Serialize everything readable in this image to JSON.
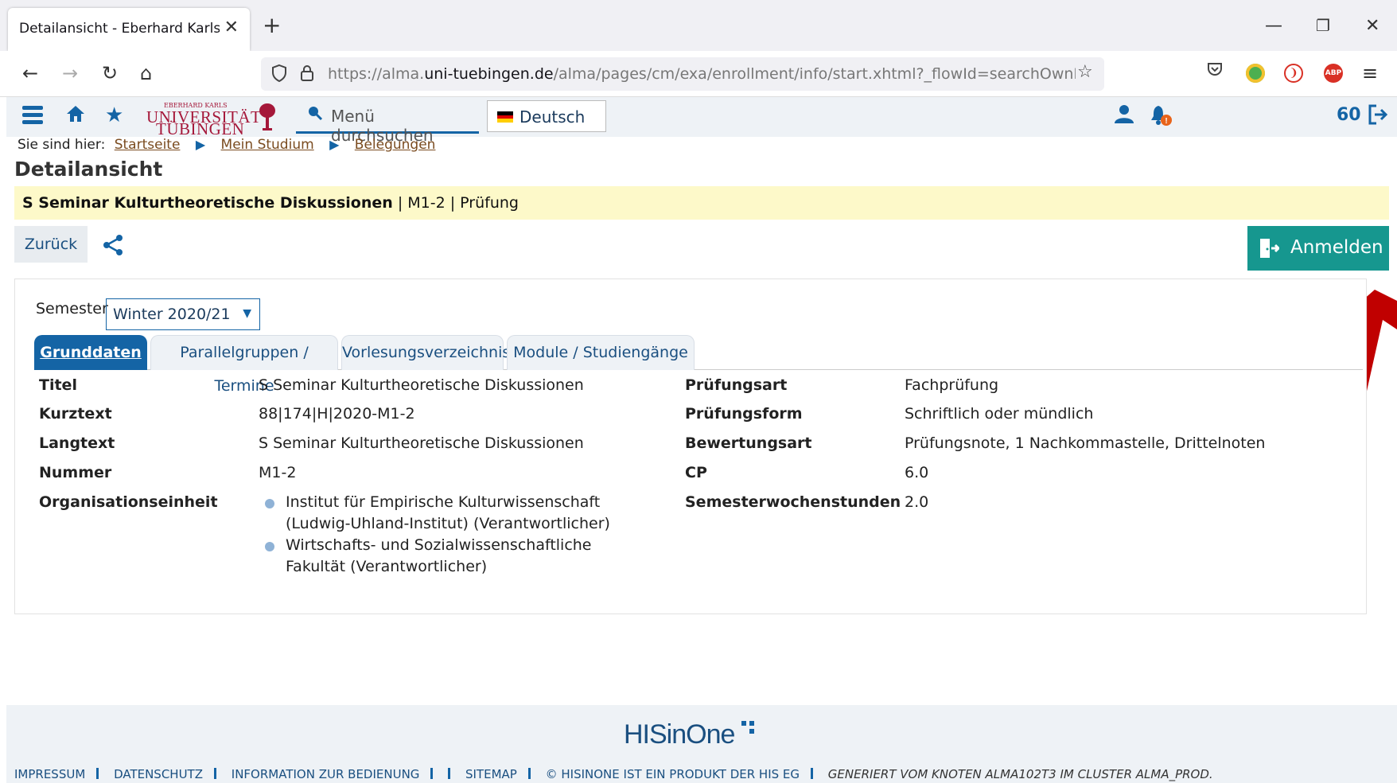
{
  "browser": {
    "tab_title": "Detailansicht - Eberhard Karls Unive",
    "url_prefix": "https://alma.",
    "url_domain": "uni-tuebingen.de",
    "url_path": "/alma/pages/cm/exa/enrollment/info/start.xhtml?_flowId=searchOwnEnrollmentIn"
  },
  "header": {
    "logo_sub": "EBERHARD KARLS",
    "logo_line1": "UNIVERSITÄT",
    "logo_line2": "TÜBINGEN",
    "menu_search": "Menü durchsuchen",
    "language": "Deutsch",
    "counter": "60"
  },
  "breadcrumb": {
    "prefix": "Sie sind hier:",
    "items": [
      "Startseite",
      "Mein Studium",
      "Belegungen"
    ]
  },
  "page_title": "Detailansicht",
  "course_bar": "S Seminar Kulturtheoretische Diskussionen",
  "course_bar_suffix": " | M1-2 | Prüfung",
  "actions": {
    "back": "Zurück",
    "register": "Anmelden"
  },
  "semester": {
    "label": "Semester",
    "selected": "Winter 2020/21"
  },
  "tabs": [
    "Grunddaten",
    "Parallelgruppen / Termine",
    "Vorlesungsverzeichnis",
    "Module / Studiengänge"
  ],
  "details_left": [
    {
      "label": "Titel",
      "value": "S Seminar Kulturtheoretische Diskussionen"
    },
    {
      "label": "Kurztext",
      "value": "88|174|H|2020-M1-2"
    },
    {
      "label": "Langtext",
      "value": "S Seminar Kulturtheoretische Diskussionen"
    },
    {
      "label": "Nummer",
      "value": "M1-2"
    },
    {
      "label": "Organisationseinheit"
    }
  ],
  "org_units": [
    {
      "line1": "Institut für Empirische Kulturwissenschaft",
      "line2": "(Ludwig-Uhland-Institut) (Verantwortlicher)"
    },
    {
      "line1": "Wirtschafts- und Sozialwissenschaftliche",
      "line2": "Fakultät (Verantwortlicher)"
    }
  ],
  "details_right": [
    {
      "label": "Prüfungsart",
      "value": "Fachprüfung"
    },
    {
      "label": "Prüfungsform",
      "value": "Schriftlich oder mündlich"
    },
    {
      "label": "Bewertungsart",
      "value": "Prüfungsnote, 1 Nachkommastelle, Drittelnoten"
    },
    {
      "label": "CP",
      "value": "6.0"
    },
    {
      "label": "Semesterwochenstunden",
      "value": "2.0"
    }
  ],
  "footer": {
    "brand": "HISinOne",
    "links": [
      "IMPRESSUM",
      "DATENSCHUTZ",
      "INFORMATION ZUR BEDIENUNG",
      "",
      "SITEMAP",
      "© HISINONE IST EIN PRODUKT DER HIS EG"
    ],
    "generated": "GENERIERT VOM KNOTEN ALMA102T3 IM CLUSTER ALMA_PROD."
  },
  "colors": {
    "primary_blue": "#1464a5",
    "register_green": "#16978f",
    "highlight_yellow": "#fdf9c9",
    "annotation_arrow": "#c00000"
  }
}
